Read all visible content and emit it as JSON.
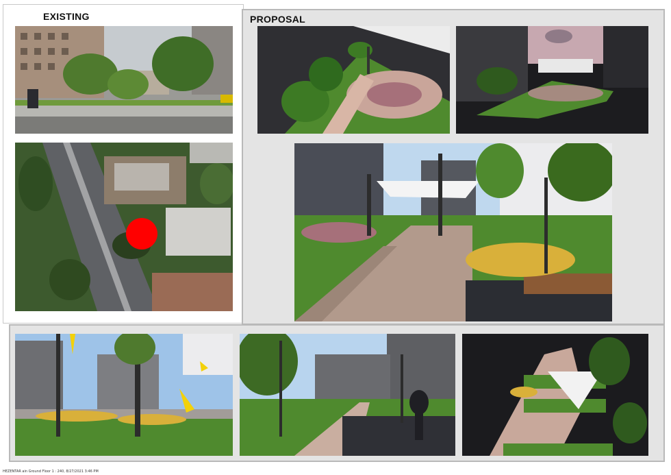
{
  "sections": {
    "existing_label": "EXISTING",
    "proposal_label": "PROPOSAL"
  },
  "footer": {
    "caption": "HEZENTAR ain Ground Floor 1 : 240, 8/27/2021 3:46 PM"
  },
  "colors": {
    "marker": "#ff0000",
    "panel_background": "#e4e4e4",
    "panel_border": "#b9b9b9"
  }
}
